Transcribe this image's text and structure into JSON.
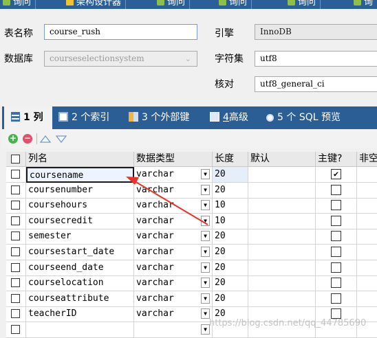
{
  "top_tabs": [
    {
      "label": "询问"
    },
    {
      "label": "架构设计器"
    },
    {
      "label": "询问"
    },
    {
      "label": "询问"
    },
    {
      "label": "询问"
    },
    {
      "label": "询"
    }
  ],
  "form": {
    "table_name_label": "表名称",
    "table_name_value": "course_rush",
    "database_label": "数据库",
    "database_value": "courseselectionsystem",
    "engine_label": "引擎",
    "engine_value": "InnoDB",
    "charset_label": "字符集",
    "charset_value": "utf8",
    "collation_label": "核对",
    "collation_value": "utf8_general_ci"
  },
  "tabs": [
    {
      "prefix": "1",
      "label": "列",
      "active": true
    },
    {
      "prefix": "2",
      "label": "个索引"
    },
    {
      "prefix": "3",
      "label": "个外部键"
    },
    {
      "prefix": "4",
      "label": "高级"
    },
    {
      "prefix": "5",
      "label": "个 SQL 预览"
    }
  ],
  "grid": {
    "headers": [
      "列名",
      "数据类型",
      "长度",
      "默认",
      "主键?",
      "非空"
    ],
    "rows": [
      {
        "name": "coursename",
        "type": "varchar",
        "length": "20",
        "pk": true
      },
      {
        "name": "coursenumber",
        "type": "varchar",
        "length": "20",
        "pk": false
      },
      {
        "name": "coursehours",
        "type": "varchar",
        "length": "10",
        "pk": false
      },
      {
        "name": "coursecredit",
        "type": "varchar",
        "length": "10",
        "pk": false
      },
      {
        "name": "semester",
        "type": "varchar",
        "length": "20",
        "pk": false
      },
      {
        "name": "coursestart_date",
        "type": "varchar",
        "length": "20",
        "pk": false
      },
      {
        "name": "courseend_date",
        "type": "varchar",
        "length": "20",
        "pk": false
      },
      {
        "name": "courselocation",
        "type": "varchar",
        "length": "20",
        "pk": false
      },
      {
        "name": "courseattribute",
        "type": "varchar",
        "length": "20",
        "pk": false
      },
      {
        "name": "teacherID",
        "type": "varchar",
        "length": "20",
        "pk": false
      },
      {
        "name": "",
        "type": "",
        "length": "",
        "pk": false
      }
    ]
  },
  "watermark": "https://blog.csdn.net/qq_44785690",
  "colors": {
    "tab_bar": "#2b5e95",
    "arrow": "#e8322a",
    "selection": "#1a1a1a"
  }
}
